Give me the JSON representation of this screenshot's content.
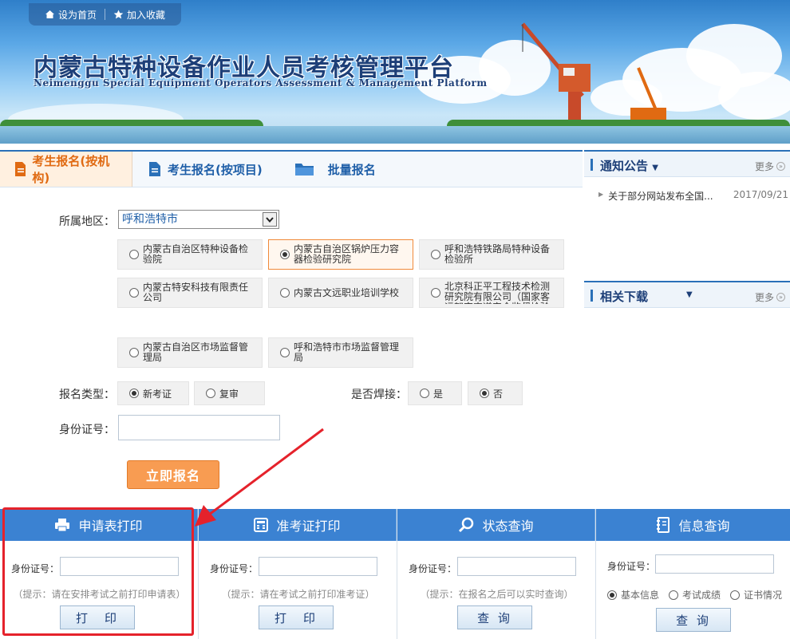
{
  "topnav": {
    "home": "设为首页",
    "favorite": "加入收藏"
  },
  "banner": {
    "title_cn": "内蒙古特种设备作业人员考核管理平台",
    "title_en": "Neimenggu Special Equipment Operators Assessment & Management Platform"
  },
  "tabs": [
    {
      "label": "考生报名(按机构)",
      "icon": "document-icon",
      "active": true
    },
    {
      "label": "考生报名(按项目)",
      "icon": "document-icon",
      "active": false
    },
    {
      "label": "批量报名",
      "icon": "folder-icon",
      "active": false
    }
  ],
  "form": {
    "region_label": "所属地区：",
    "region_value": "呼和浩特市",
    "institutions": [
      {
        "label": "内蒙古自治区特种设备检验院",
        "selected": false
      },
      {
        "label": "内蒙古自治区锅炉压力容器检验研究院",
        "selected": true
      },
      {
        "label": "呼和浩特铁路局特种设备检验所",
        "selected": false
      },
      {
        "label": "内蒙古特安科技有限责任公司",
        "selected": false
      },
      {
        "label": "内蒙古文远职业培训学校",
        "selected": false
      },
      {
        "label": "北京科正平工程技术检测研究院有限公司（国家客运架空索道安全监督检验中心）",
        "selected": false
      },
      {
        "label": "内蒙古自治区市场监督管理局",
        "selected": false
      },
      {
        "label": "呼和浩特市市场监督管理局",
        "selected": false
      }
    ],
    "type_label": "报名类型：",
    "type_options": [
      {
        "label": "新考证",
        "selected": true
      },
      {
        "label": "复审",
        "selected": false
      }
    ],
    "welding_label": "是否焊接：",
    "welding_options": [
      {
        "label": "是",
        "selected": false
      },
      {
        "label": "否",
        "selected": true
      }
    ],
    "id_label": "身份证号：",
    "submit": "立即报名"
  },
  "notice": {
    "title": "通知公告",
    "more": "更多",
    "items": [
      {
        "text": "关于部分网站发布全国...",
        "date": "2017/09/21"
      }
    ]
  },
  "downloads": {
    "title": "相关下载",
    "more": "更多"
  },
  "panels": [
    {
      "title": "申请表打印",
      "icon": "printer-icon",
      "id_label": "身份证号：",
      "hint": "（提示：请在安排考试之前打印申请表）",
      "button": "打　印"
    },
    {
      "title": "准考证打印",
      "icon": "calculator-icon",
      "id_label": "身份证号：",
      "hint": "（提示：请在考试之前打印准考证）",
      "button": "打　印"
    },
    {
      "title": "状态查询",
      "icon": "search-icon",
      "id_label": "身份证号：",
      "hint": "（提示：在报名之后可以实时查询）",
      "button": "查 询"
    },
    {
      "title": "信息查询",
      "icon": "notebook-icon",
      "id_label": "身份证号：",
      "button": "查 询",
      "radios": [
        {
          "label": "基本信息",
          "selected": true
        },
        {
          "label": "考试成绩",
          "selected": false
        },
        {
          "label": "证书情况",
          "selected": false
        }
      ]
    }
  ],
  "colors": {
    "brand_blue": "#2a70b8",
    "panel_blue": "#3b82d2",
    "accent_orange": "#f89c52",
    "highlight_red": "#e5222b"
  }
}
